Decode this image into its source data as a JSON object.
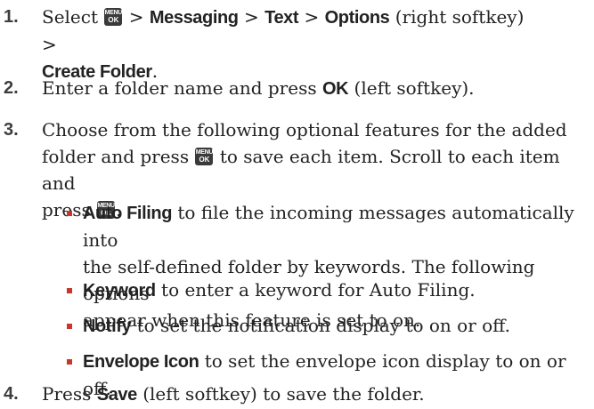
{
  "key_icon": {
    "line1": "MENU",
    "line2": "OK"
  },
  "steps": [
    {
      "num": "1.",
      "select": "Select",
      "gt1": ">",
      "messaging": "Messaging",
      "gt2": ">",
      "text": "Text",
      "gt3": ">",
      "options": "Options",
      "options_note": "(right softkey) >",
      "create_folder": "Create Folder",
      "end": "."
    },
    {
      "num": "2.",
      "pre": "Enter a folder name and press",
      "ok": "OK",
      "post": "(left softkey)."
    },
    {
      "num": "3.",
      "line1": "Choose from the following optional features for the added",
      "line2a": "folder and press",
      "line2b": "to save each item. Scroll to each item and",
      "line3a": "press",
      "line3b": "."
    },
    {
      "num": "4.",
      "pre": "Press",
      "save": "Save",
      "post": "(left softkey) to save the folder."
    }
  ],
  "bullets": [
    {
      "term": "Auto Filing",
      "l1": "to file the incoming messages automatically into",
      "l2": "the self-defined folder by keywords. The following options",
      "l3": "appear when this feature is set to on."
    },
    {
      "term": "Keyword",
      "desc": "to enter a keyword for Auto Filing."
    },
    {
      "term": "Notify",
      "desc": "to set the notification display to on or off."
    },
    {
      "term": "Envelope Icon",
      "desc": "to set the envelope icon display to on or off."
    }
  ],
  "colors": {
    "bullet": "#c8372a",
    "key_bg": "#3a3a3a",
    "text": "#222222"
  }
}
